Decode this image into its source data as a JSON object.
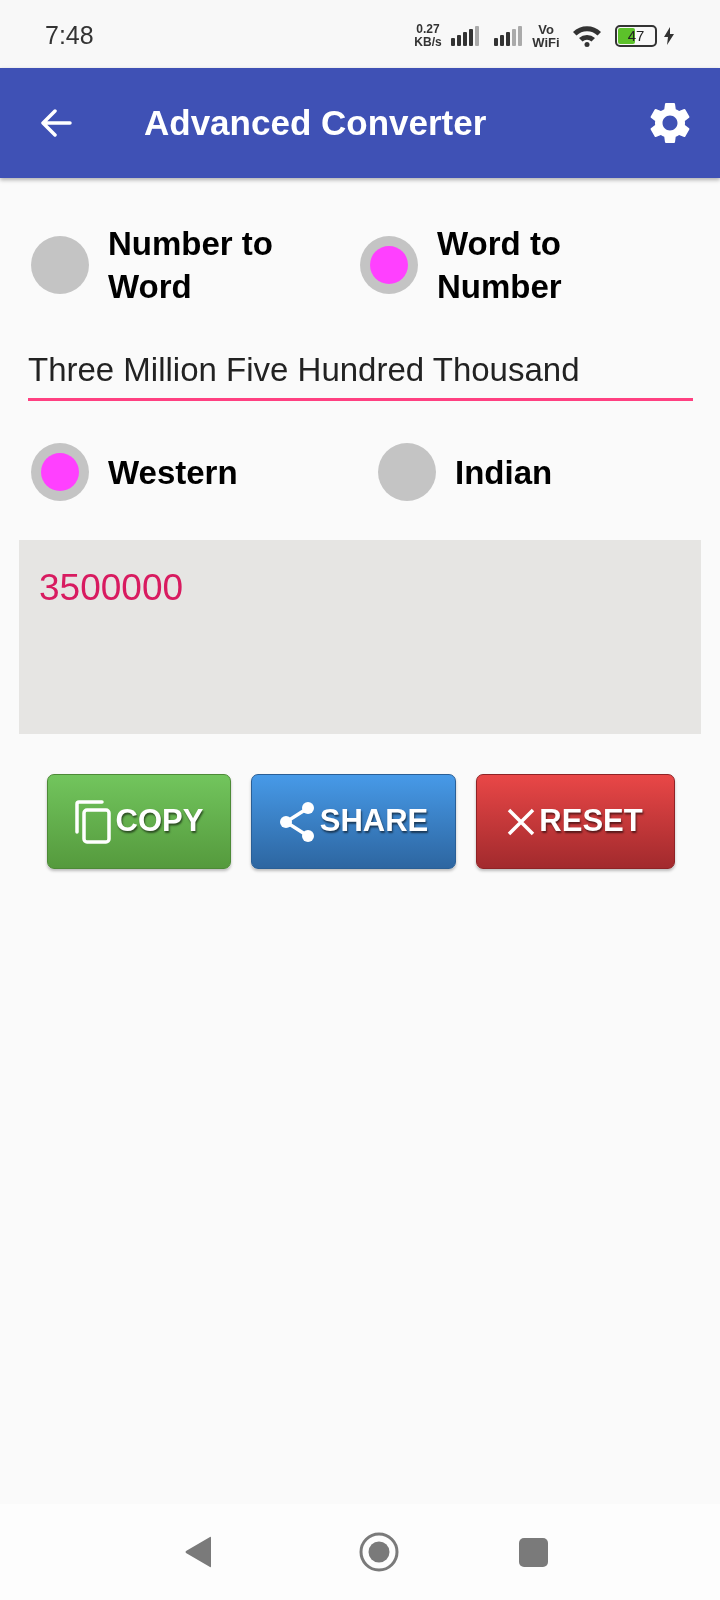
{
  "status_bar": {
    "time": "7:48",
    "data_speed": "0.27 KB/s",
    "call_mode": "Vo WiFi",
    "battery": "47"
  },
  "app_bar": {
    "title": "Advanced Converter"
  },
  "mode_options": [
    {
      "label": "Number to Word",
      "selected": false
    },
    {
      "label": "Word to Number",
      "selected": true
    }
  ],
  "input": {
    "value": "Three Million Five Hundred Thousand"
  },
  "system_options": [
    {
      "label": "Western",
      "selected": true
    },
    {
      "label": "Indian",
      "selected": false
    }
  ],
  "result": {
    "value": "3500000"
  },
  "buttons": [
    {
      "kind": "copy",
      "label": "COPY"
    },
    {
      "kind": "share",
      "label": "SHARE"
    },
    {
      "kind": "reset",
      "label": "RESET"
    }
  ]
}
